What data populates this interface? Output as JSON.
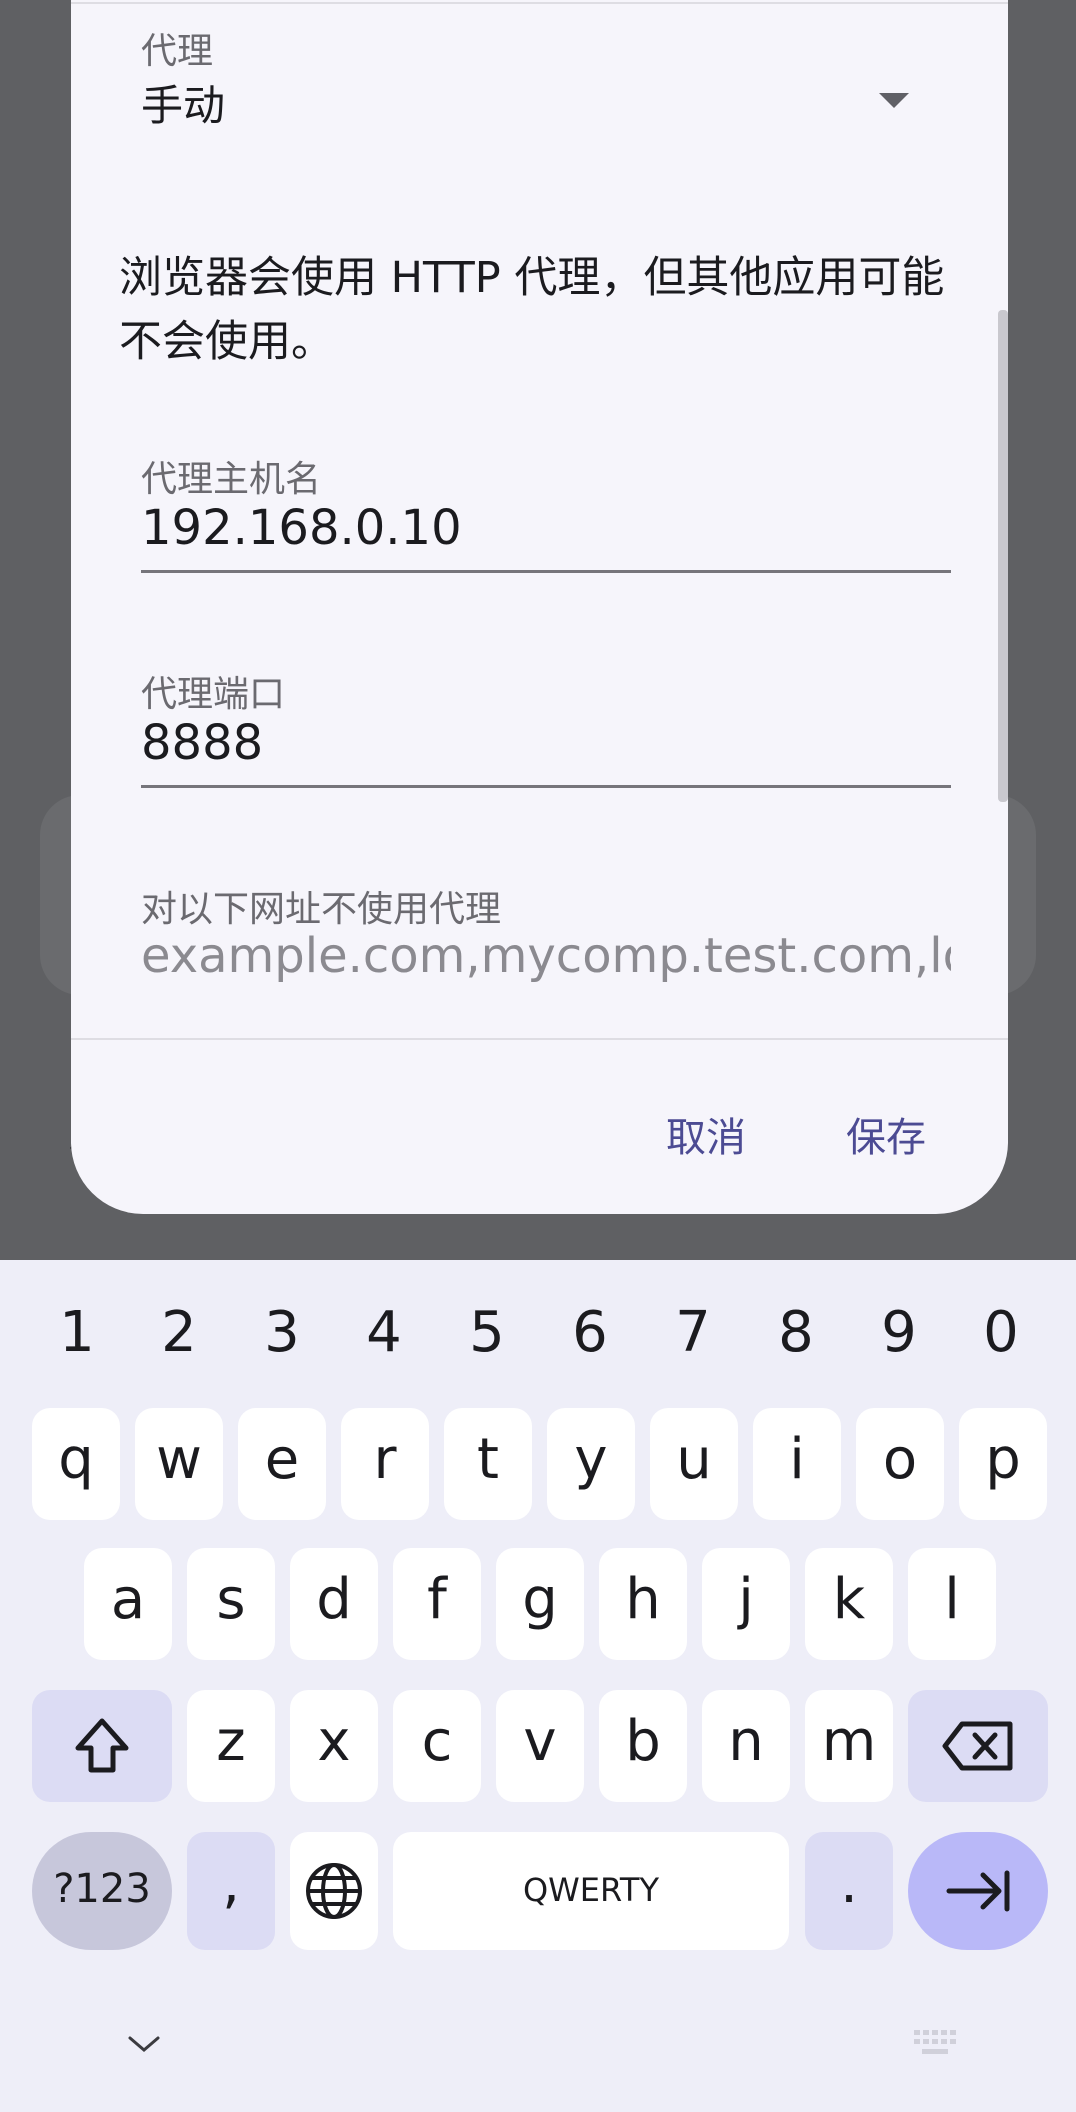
{
  "dialog": {
    "proxy_label": "代理",
    "proxy_value": "手动",
    "info_text": "浏览器会使用 HTTP 代理，但其他应用可能不会使用。",
    "hostname_label": "代理主机名",
    "hostname_value": "192.168.0.10",
    "port_label": "代理端口",
    "port_value": "8888",
    "bypass_label": "对以下网址不使用代理",
    "bypass_placeholder": "example.com,mycomp.test.com,lo",
    "cancel_label": "取消",
    "save_label": "保存",
    "accent_color": "#4c4b93"
  },
  "keyboard": {
    "number_row": [
      "1",
      "2",
      "3",
      "4",
      "5",
      "6",
      "7",
      "8",
      "9",
      "0"
    ],
    "row1": [
      "q",
      "w",
      "e",
      "r",
      "t",
      "y",
      "u",
      "i",
      "o",
      "p"
    ],
    "row2": [
      "a",
      "s",
      "d",
      "f",
      "g",
      "h",
      "j",
      "k",
      "l"
    ],
    "row3": [
      "z",
      "x",
      "c",
      "v",
      "b",
      "n",
      "m"
    ],
    "symbols_label": "?123",
    "comma_label": ",",
    "space_label": "QWERTY",
    "period_label": ".",
    "icons": {
      "shift": "shift-icon",
      "backspace": "backspace-icon",
      "language": "globe-icon",
      "enter": "tab-arrow-icon",
      "hide": "chevron-down-icon",
      "switch": "keyboard-icon"
    }
  }
}
